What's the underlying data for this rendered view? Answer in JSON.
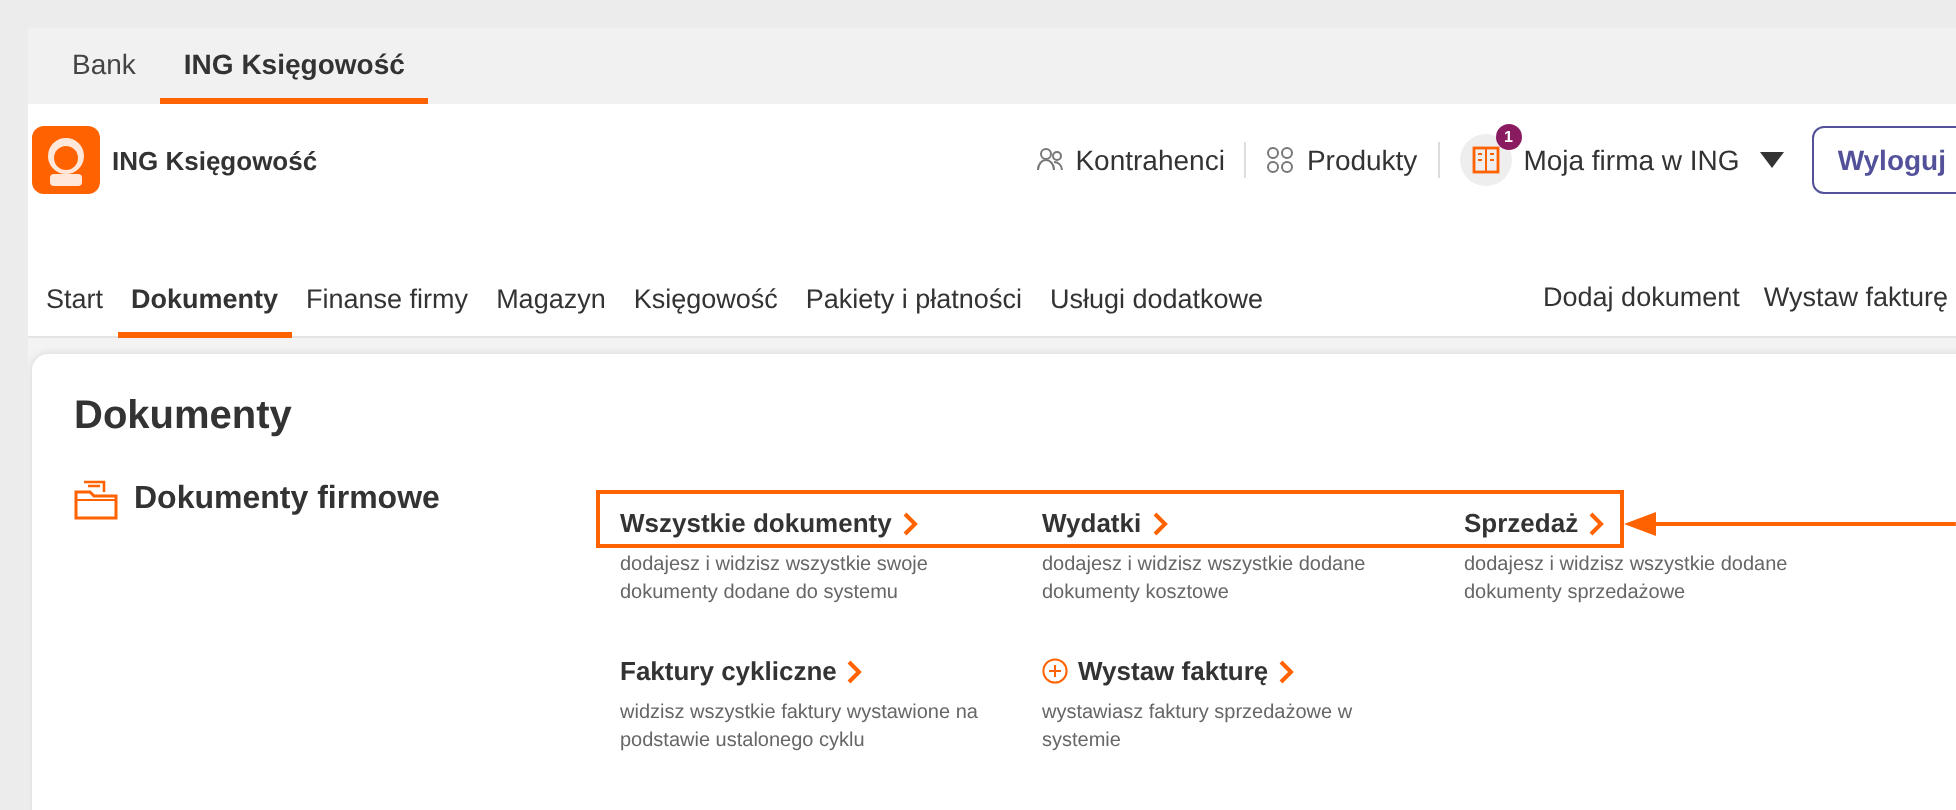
{
  "top_tabs": [
    {
      "label": "Bank",
      "selected": false
    },
    {
      "label": "ING Księgowość",
      "selected": true
    }
  ],
  "header": {
    "brand": "ING Księgowość",
    "links": [
      {
        "label": "Kontrahenci",
        "kind": "people"
      },
      {
        "label": "Produkty",
        "kind": "grid"
      }
    ],
    "company": {
      "label": "Moja firma w ING",
      "badge": "1"
    },
    "logout": "Wyloguj"
  },
  "nav": {
    "items": [
      {
        "label": "Start",
        "selected": false
      },
      {
        "label": "Dokumenty",
        "selected": true
      },
      {
        "label": "Finanse firmy",
        "selected": false
      },
      {
        "label": "Magazyn",
        "selected": false
      },
      {
        "label": "Księgowość",
        "selected": false
      },
      {
        "label": "Pakiety i płatności",
        "selected": false
      },
      {
        "label": "Usługi dodatkowe",
        "selected": false
      }
    ],
    "actions": [
      "Dodaj dokument",
      "Wystaw fakturę"
    ]
  },
  "content": {
    "title": "Dokumenty",
    "section": {
      "title": "Dokumenty firmowe",
      "links": [
        {
          "title": "Wszystkie dokumenty",
          "description": "dodajesz i widzisz wszystkie swoje dokumenty dodane do systemu",
          "kind": "plain",
          "highlighted": true
        },
        {
          "title": "Wydatki",
          "description": "dodajesz i widzisz wszystkie dodane dokumenty kosztowe",
          "kind": "plain",
          "highlighted": true
        },
        {
          "title": "Sprzedaż",
          "description": "dodajesz i widzisz wszystkie dodane dokumenty sprzedażowe",
          "kind": "plain",
          "highlighted": true
        },
        {
          "title": "Faktury cykliczne",
          "description": "widzisz wszystkie faktury wystawione na podstawie ustalonego cyklu",
          "kind": "plain",
          "highlighted": false
        },
        {
          "title": "Wystaw fakturę",
          "description": "wystawiasz faktury sprzedażowe w systemie",
          "kind": "add",
          "highlighted": false
        }
      ]
    }
  }
}
